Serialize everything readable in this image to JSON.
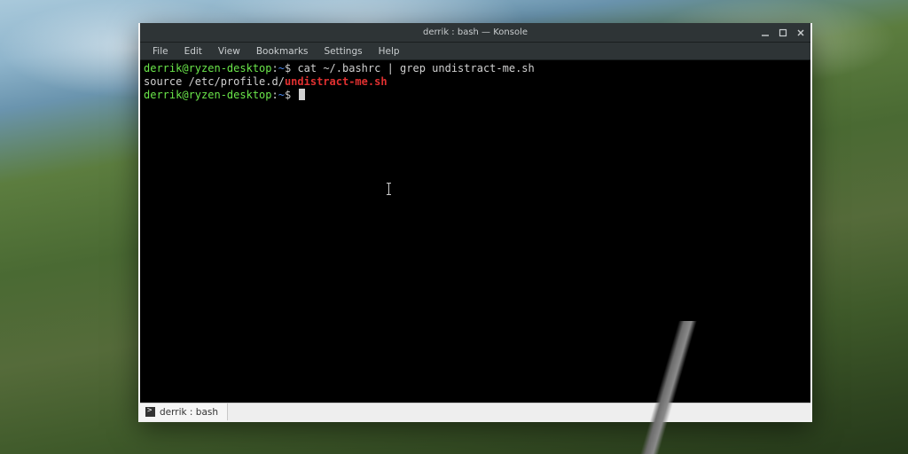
{
  "window": {
    "title": "derrik : bash — Konsole"
  },
  "menus": {
    "file": "File",
    "edit": "Edit",
    "view": "View",
    "bookmarks": "Bookmarks",
    "settings": "Settings",
    "help": "Help"
  },
  "terminal": {
    "prompt": {
      "userhost": "derrik@ryzen-desktop",
      "colon": ":",
      "path": "~",
      "symbol": "$"
    },
    "command": "cat ~/.bashrc | grep undistract-me.sh",
    "output_prefix": "source /etc/profile.d/",
    "output_match": "undistract-me.sh"
  },
  "tab": {
    "label": "derrik : bash"
  }
}
